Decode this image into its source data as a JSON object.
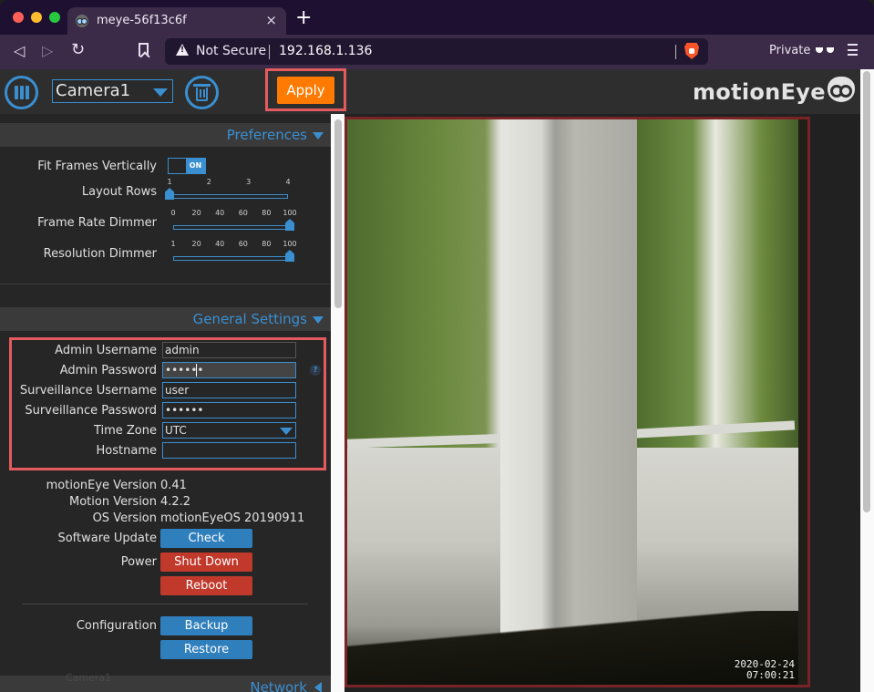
{
  "browser": {
    "tab_title": "meye-56f13c6f",
    "tab_close": "×",
    "new_tab": "+",
    "back": "◁",
    "forward": "▷",
    "reload": "↻",
    "security_label": "Not Secure",
    "url": "192.168.1.136",
    "private_label": "Private"
  },
  "header": {
    "camera_selected": "Camera1",
    "apply_label": "Apply",
    "logo_text": "motionEye"
  },
  "preferences": {
    "title": "Preferences",
    "fit_frames": {
      "label": "Fit Frames Vertically",
      "state": "ON"
    },
    "layout_rows": {
      "label": "Layout Rows",
      "ticks": [
        "1",
        "2",
        "3",
        "4"
      ],
      "value": 1,
      "min": 1,
      "max": 4
    },
    "frame_rate_dimmer": {
      "label": "Frame Rate Dimmer",
      "ticks": [
        "0",
        "20",
        "40",
        "60",
        "80",
        "100"
      ],
      "value": 100,
      "min": 0,
      "max": 100
    },
    "resolution_dimmer": {
      "label": "Resolution Dimmer",
      "ticks": [
        "1",
        "20",
        "40",
        "60",
        "80",
        "100"
      ],
      "value": 100,
      "min": 1,
      "max": 100
    }
  },
  "general": {
    "title": "General Settings",
    "admin_username": {
      "label": "Admin Username",
      "value": "admin"
    },
    "admin_password": {
      "label": "Admin Password",
      "value": "••••••"
    },
    "surveillance_username": {
      "label": "Surveillance Username",
      "value": "user"
    },
    "surveillance_password": {
      "label": "Surveillance Password",
      "value": "••••••"
    },
    "time_zone": {
      "label": "Time Zone",
      "value": "UTC"
    },
    "hostname": {
      "label": "Hostname",
      "value": ""
    },
    "help": "?",
    "motioneye_version": {
      "label": "motionEye Version",
      "value": "0.41"
    },
    "motion_version": {
      "label": "Motion Version",
      "value": "4.2.2"
    },
    "os_version": {
      "label": "OS Version",
      "value": "motionEyeOS 20190911"
    },
    "software_update": {
      "label": "Software Update",
      "button": "Check"
    },
    "power": {
      "label": "Power",
      "shutdown": "Shut Down",
      "reboot": "Reboot"
    },
    "configuration": {
      "label": "Configuration",
      "backup": "Backup",
      "restore": "Restore"
    }
  },
  "footer": {
    "camera_name": "Camera1",
    "next_section": "Network"
  },
  "camera": {
    "date": "2020-02-24",
    "time": "07:00:21"
  },
  "colors": {
    "accent": "#3a8fd1",
    "apply": "#ff7a00",
    "danger": "#c0392b",
    "highlight": "#e35b5f",
    "frame_border": "#7a2327"
  }
}
